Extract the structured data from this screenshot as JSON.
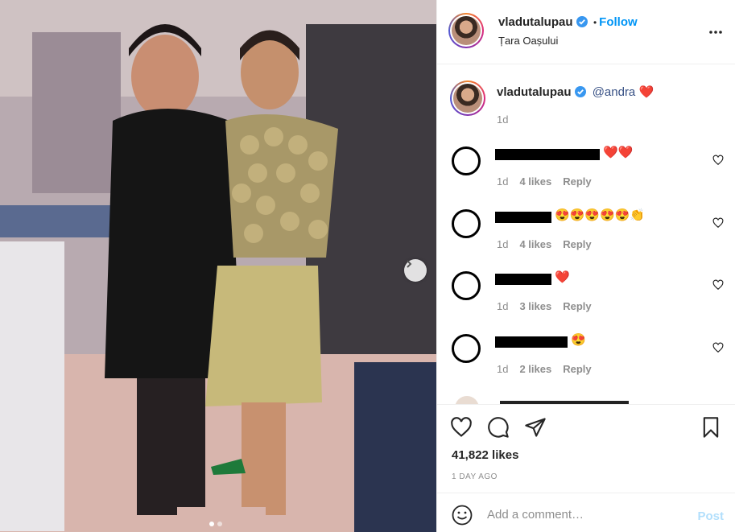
{
  "post": {
    "username": "vladutalupau",
    "follow_label": "Follow",
    "separator": "•",
    "location": "Țara Oașului"
  },
  "caption": {
    "username": "vladutalupau",
    "mention": "@andra",
    "emoji": "❤️",
    "time": "1d"
  },
  "comments": [
    {
      "emoji": "❤️❤️",
      "time": "1d",
      "likes": "4 likes",
      "reply": "Reply"
    },
    {
      "emoji": "😍😍😍😍😍👏",
      "time": "1d",
      "likes": "4 likes",
      "reply": "Reply"
    },
    {
      "emoji": "❤️",
      "time": "1d",
      "likes": "3 likes",
      "reply": "Reply"
    },
    {
      "emoji": "😍",
      "time": "1d",
      "likes": "2 likes",
      "reply": "Reply"
    }
  ],
  "stats": {
    "likes": "41,822 likes",
    "ago": "1 DAY AGO"
  },
  "composer": {
    "placeholder": "Add a comment…",
    "post_label": "Post"
  },
  "colors": {
    "accent": "#0095f6",
    "verified": "#3897f0",
    "heart": "#ed4956",
    "post_disabled": "#b2dffc"
  },
  "icons": [
    "more-icon",
    "verified-icon",
    "heart-icon",
    "comment-icon",
    "share-icon",
    "bookmark-icon",
    "smiley-icon",
    "chevron-right-icon"
  ]
}
